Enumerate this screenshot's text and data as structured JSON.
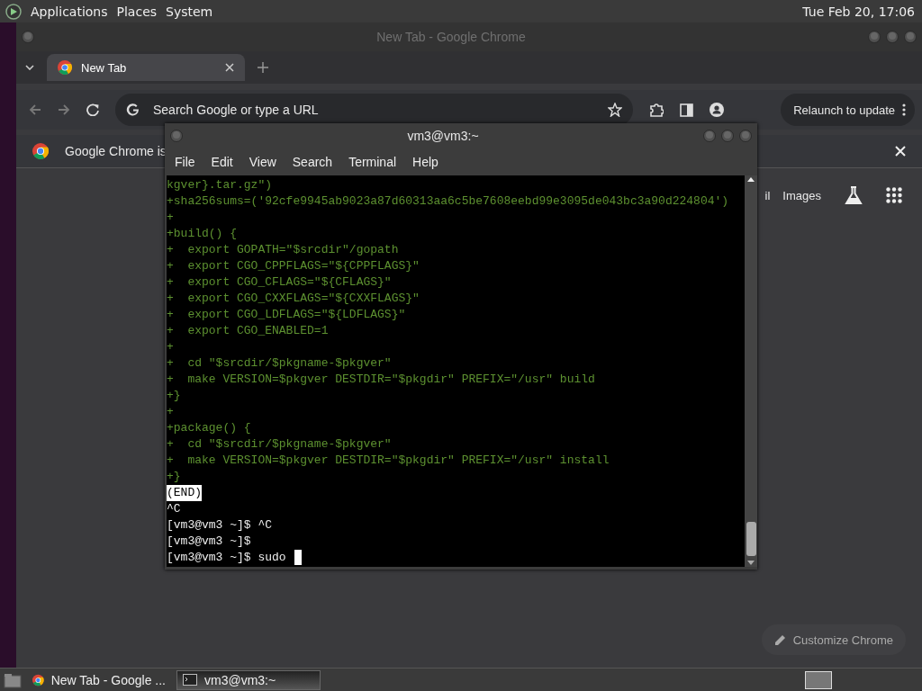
{
  "top_panel": {
    "menus": [
      "Applications",
      "Places",
      "System"
    ],
    "clock": "Tue Feb 20, 17:06"
  },
  "browser": {
    "title": "New Tab - Google Chrome",
    "tabs": [
      {
        "label": "New Tab",
        "selected": true
      }
    ],
    "omnibox": {
      "placeholder": "Search Google or type a URL"
    },
    "relaunch_button": "Relaunch to update",
    "infobar": {
      "text": "Google Chrome is"
    },
    "ntp_links": [
      "il",
      "Images"
    ],
    "customize_button": "Customize Chrome"
  },
  "terminal": {
    "title": "vm3@vm3:~",
    "menus": [
      "File",
      "Edit",
      "View",
      "Search",
      "Terminal",
      "Help"
    ],
    "cursor": true,
    "lines": [
      {
        "kind": "diff",
        "text": "kgver}.tar.gz\")"
      },
      {
        "kind": "diff",
        "text": "+sha256sums=('92cfe9945ab9023a87d60313aa6c5be7608eebd99e3095de043bc3a90d224804')"
      },
      {
        "kind": "diff",
        "text": "+"
      },
      {
        "kind": "diff",
        "text": "+build() {"
      },
      {
        "kind": "diff",
        "text": "+  export GOPATH=\"$srcdir\"/gopath"
      },
      {
        "kind": "diff",
        "text": "+  export CGO_CPPFLAGS=\"${CPPFLAGS}\""
      },
      {
        "kind": "diff",
        "text": "+  export CGO_CFLAGS=\"${CFLAGS}\""
      },
      {
        "kind": "diff",
        "text": "+  export CGO_CXXFLAGS=\"${CXXFLAGS}\""
      },
      {
        "kind": "diff",
        "text": "+  export CGO_LDFLAGS=\"${LDFLAGS}\""
      },
      {
        "kind": "diff",
        "text": "+  export CGO_ENABLED=1"
      },
      {
        "kind": "diff",
        "text": "+"
      },
      {
        "kind": "diff",
        "text": "+  cd \"$srcdir/$pkgname-$pkgver\""
      },
      {
        "kind": "diff",
        "text": "+  make VERSION=$pkgver DESTDIR=\"$pkgdir\" PREFIX=\"/usr\" build"
      },
      {
        "kind": "diff",
        "text": "+}"
      },
      {
        "kind": "diff",
        "text": "+"
      },
      {
        "kind": "diff",
        "text": "+package() {"
      },
      {
        "kind": "diff",
        "text": "+  cd \"$srcdir/$pkgname-$pkgver\""
      },
      {
        "kind": "diff",
        "text": "+  make VERSION=$pkgver DESTDIR=\"$pkgdir\" PREFIX=\"/usr\" install"
      },
      {
        "kind": "diff",
        "text": "+}"
      },
      {
        "kind": "inverse",
        "text": "(END)"
      },
      {
        "kind": "plain",
        "text": "^C"
      },
      {
        "kind": "plain",
        "text": "[vm3@vm3 ~]$ ^C"
      },
      {
        "kind": "plain",
        "text": "[vm3@vm3 ~]$"
      },
      {
        "kind": "plain",
        "text": "[vm3@vm3 ~]$ sudo"
      }
    ]
  },
  "taskbar": {
    "items": [
      {
        "kind": "browser",
        "label": "New Tab - Google ...",
        "selected": false
      },
      {
        "kind": "terminal",
        "label": "vm3@vm3:~",
        "selected": true
      }
    ]
  }
}
